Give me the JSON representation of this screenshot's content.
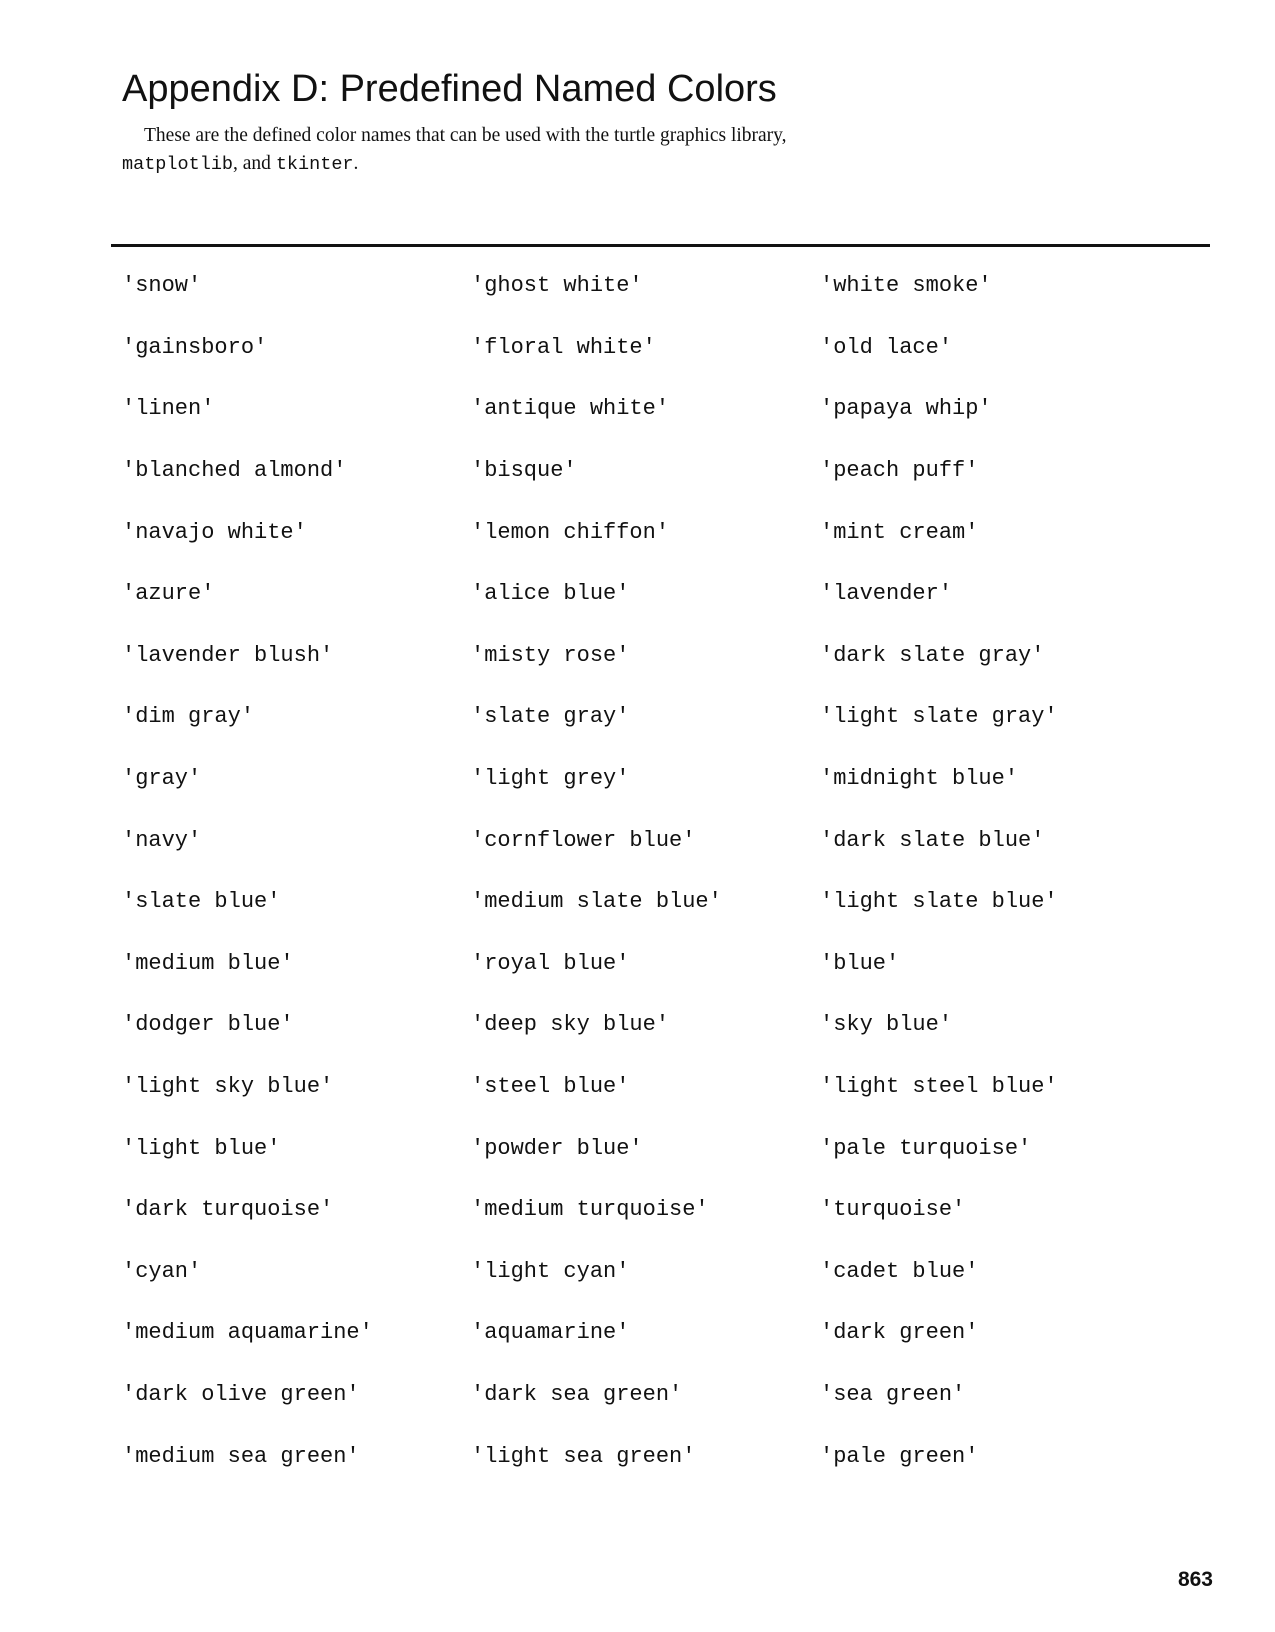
{
  "heading": {
    "title": "Appendix D: Predefined Named Colors"
  },
  "intro": {
    "text_before": "These are the defined color names that can be used with the turtle graphics library,",
    "lib_matplotlib": "matplotlib",
    "sep_and": ", and ",
    "lib_tkinter": "tkinter",
    "end_period": "."
  },
  "colors": [
    [
      "'snow'",
      "'ghost white'",
      "'white smoke'"
    ],
    [
      "'gainsboro'",
      "'floral white'",
      "'old lace'"
    ],
    [
      "'linen'",
      "'antique white'",
      "'papaya whip'"
    ],
    [
      "'blanched almond'",
      "'bisque'",
      "'peach puff'"
    ],
    [
      "'navajo white'",
      "'lemon chiffon'",
      "'mint cream'"
    ],
    [
      "'azure'",
      "'alice blue'",
      "'lavender'"
    ],
    [
      "'lavender blush'",
      "'misty rose'",
      "'dark slate gray'"
    ],
    [
      "'dim gray'",
      "'slate gray'",
      "'light slate gray'"
    ],
    [
      "'gray'",
      "'light grey'",
      "'midnight blue'"
    ],
    [
      "'navy'",
      "'cornflower blue'",
      "'dark slate blue'"
    ],
    [
      "'slate blue'",
      "'medium slate blue'",
      "'light slate blue'"
    ],
    [
      "'medium blue'",
      "'royal blue'",
      "'blue'"
    ],
    [
      "'dodger blue'",
      "'deep sky blue'",
      "'sky blue'"
    ],
    [
      "'light sky blue'",
      "'steel blue'",
      "'light steel blue'"
    ],
    [
      "'light blue'",
      "'powder blue'",
      "'pale turquoise'"
    ],
    [
      "'dark turquoise'",
      "'medium turquoise'",
      "'turquoise'"
    ],
    [
      "'cyan'",
      "'light cyan'",
      "'cadet blue'"
    ],
    [
      "'medium aquamarine'",
      "'aquamarine'",
      "'dark green'"
    ],
    [
      "'dark olive green'",
      "'dark sea green'",
      "'sea green'"
    ],
    [
      "'medium sea green'",
      "'light sea green'",
      "'pale green'"
    ]
  ],
  "footer": {
    "page_number": "863"
  }
}
